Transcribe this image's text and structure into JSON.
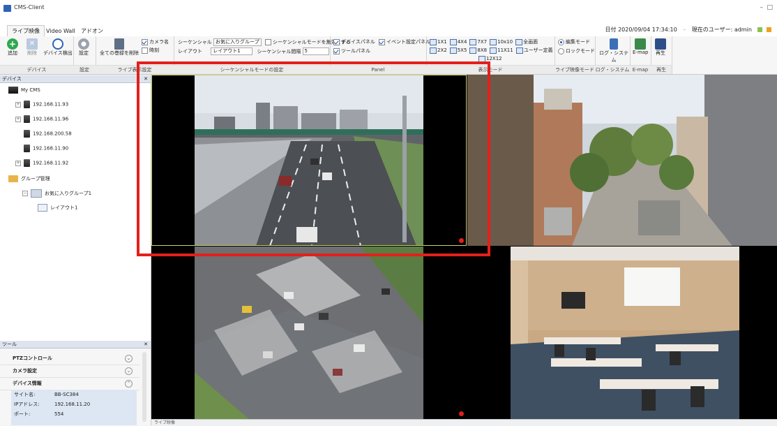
{
  "window": {
    "title": "CMS-Client",
    "minimize": "–",
    "close": "□"
  },
  "tabs": [
    {
      "label": "ライブ映像"
    },
    {
      "label": "Video Wall"
    },
    {
      "label": "アドオン"
    }
  ],
  "status": {
    "datetime": "日付 2020/09/04 17:34:10",
    "user": "現在のユーザー: admin"
  },
  "ribbon": {
    "device": {
      "add": "追加",
      "delete": "削除",
      "detect": "デバイス検出",
      "group": "デバイス"
    },
    "settings": {
      "label": "設定",
      "group": "設定"
    },
    "recorder": {
      "delete_all": "全ての巻録を削除",
      "camera_name": "カメラ名",
      "time": "時刻",
      "group": "ライブ表示設定"
    },
    "sequence": {
      "seq_label": "シーケンシャル",
      "favorite": "お気に入りグループ",
      "disable_label": "シーケンシャルモードを無効にする",
      "layout_label": "レイアウト",
      "layout_value": "レイアウト1",
      "interval_label": "シーケンシャル間隔",
      "interval_value": "5",
      "group": "シーケンシャルモードの設定"
    },
    "panel": {
      "device_panel": "デバイスパネル",
      "event_panel": "イベント設定パネル",
      "tool_panel": "ツールパネル",
      "group": "Panel"
    },
    "display": {
      "layouts_row1": [
        "1X1",
        "4X4",
        "7X7",
        "10x10",
        "全画面"
      ],
      "layouts_row2": [
        "2X2",
        "5X5",
        "8X8",
        "11X11",
        "ユーザー定義"
      ],
      "layouts_row3": "12X12",
      "group": "表示モード"
    },
    "mode": {
      "edit": "編集モード",
      "lock": "ロックモード",
      "group": "ライブ映像モード"
    },
    "log": {
      "label": "ログ・システム",
      "group": "ログ・システム"
    },
    "emap": {
      "label": "E-map",
      "group": "E-map"
    },
    "playback": {
      "label": "再生",
      "group": "再生"
    }
  },
  "device_panel": {
    "header": "デバイス",
    "root": "My CMS",
    "devices": [
      "192.168.11.93",
      "192.168.11.96",
      "192.168.200.58",
      "192.168.11.90",
      "192.168.11.92"
    ],
    "group_mgmt": "グループ管理",
    "favorite_group": "お気に入りグループ1",
    "layout": "レイアウト1"
  },
  "tool_panel": {
    "header": "ツール",
    "sections": [
      "PTZコントロール",
      "カメラ設定",
      "デバイス情報"
    ],
    "info": [
      {
        "key": "サイト名:",
        "value": "BB-SC384"
      },
      {
        "key": "IPアドレス:",
        "value": "192.168.11.20"
      },
      {
        "key": "ポート:",
        "value": "554"
      }
    ]
  },
  "video": {
    "cells": [
      {
        "name": "highway",
        "recording": true
      },
      {
        "name": "street",
        "recording": false
      },
      {
        "name": "intersection",
        "recording": true
      },
      {
        "name": "meeting-room",
        "recording": false
      }
    ]
  },
  "statusbar": {
    "text": "ライブ映像"
  },
  "colors": {
    "accent": "#2c63b6",
    "highlight": "#e3201b",
    "recording": "#e0201a"
  }
}
